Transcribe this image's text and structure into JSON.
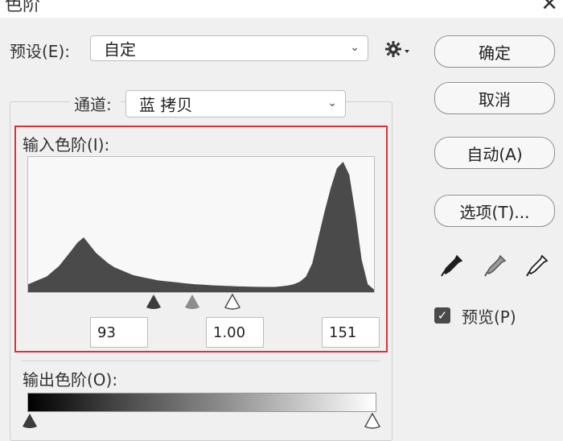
{
  "window": {
    "title": "色阶",
    "close_glyph": "✕"
  },
  "preset": {
    "label": "预设(E):",
    "value": "自定",
    "menu_icon": "gear-icon"
  },
  "channel": {
    "label": "通道:",
    "value": "蓝 拷贝"
  },
  "input_levels": {
    "label": "输入色阶(I):",
    "black": "93",
    "gamma": "1.00",
    "white": "151",
    "histogram_heights": [
      0.06,
      0.08,
      0.1,
      0.12,
      0.16,
      0.2,
      0.26,
      0.32,
      0.38,
      0.42,
      0.36,
      0.3,
      0.26,
      0.22,
      0.19,
      0.17,
      0.15,
      0.13,
      0.12,
      0.11,
      0.1,
      0.09,
      0.085,
      0.08,
      0.075,
      0.07,
      0.065,
      0.06,
      0.058,
      0.055,
      0.052,
      0.05,
      0.048,
      0.046,
      0.044,
      0.043,
      0.042,
      0.041,
      0.04,
      0.04,
      0.04,
      0.045,
      0.05,
      0.06,
      0.08,
      0.12,
      0.22,
      0.42,
      0.62,
      0.8,
      0.95,
      1.0,
      0.9,
      0.6,
      0.25,
      0.06,
      0.02
    ]
  },
  "output_levels": {
    "label": "输出色阶(O):"
  },
  "buttons": {
    "ok": "确定",
    "cancel": "取消",
    "auto": "自动(A)",
    "options": "选项(T)..."
  },
  "eyedroppers": [
    "black-eyedropper-icon",
    "gray-eyedropper-icon",
    "white-eyedropper-icon"
  ],
  "preview": {
    "label": "预览(P)",
    "checked": true
  },
  "colors": {
    "highlight_border": "#d6333c",
    "histogram_fill": "#4a4a4a"
  }
}
